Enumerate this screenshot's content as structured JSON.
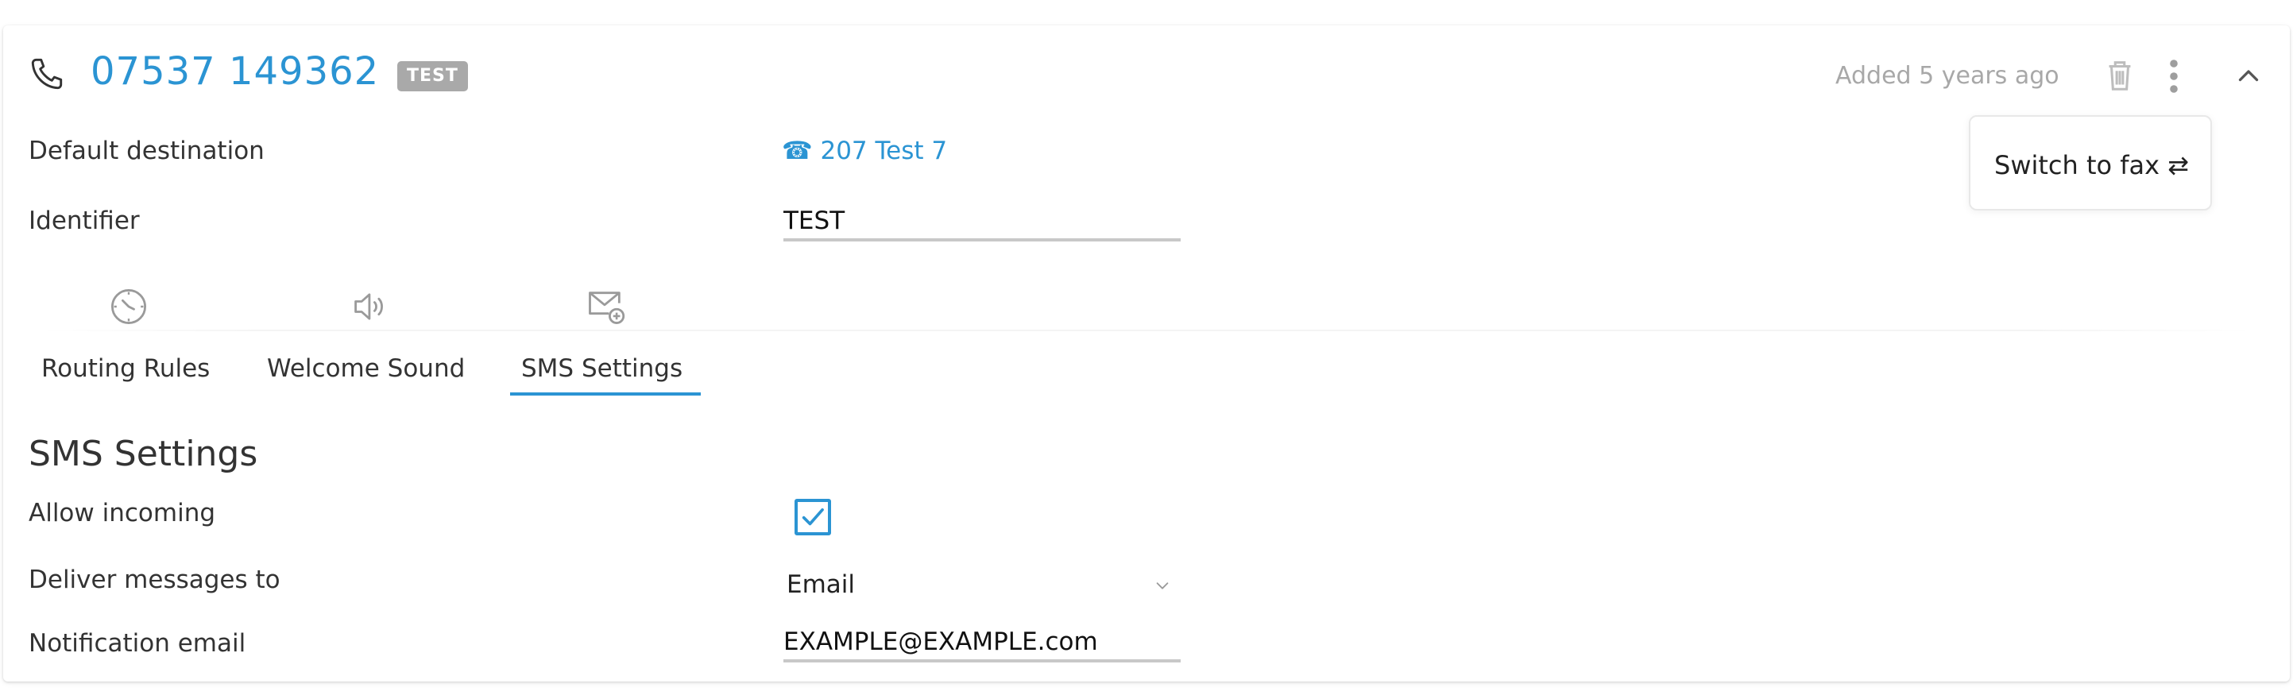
{
  "header": {
    "phone_number": "07537 149362",
    "badge": "TEST",
    "added_text": "Added 5 years ago"
  },
  "popover": {
    "switch_label": "Switch to fax ⇄"
  },
  "fields": {
    "default_destination_label": "Default destination",
    "default_destination_value": "☎ 207 Test 7",
    "identifier_label": "Identifier",
    "identifier_value": "TEST"
  },
  "tabs": [
    {
      "label": "Routing Rules",
      "icon": "clock-icon",
      "active": false
    },
    {
      "label": "Welcome Sound",
      "icon": "speaker-icon",
      "active": false
    },
    {
      "label": "SMS Settings",
      "icon": "envelope-plus-icon",
      "active": true
    }
  ],
  "sms": {
    "title": "SMS Settings",
    "allow_incoming_label": "Allow incoming",
    "allow_incoming_checked": true,
    "deliver_label": "Deliver messages to",
    "deliver_value": "Email",
    "notification_email_label": "Notification email",
    "notification_email_value": "EXAMPLE@EXAMPLE.com"
  },
  "colors": {
    "accent": "#2b94d3",
    "badge_bg": "#a9a9a9",
    "muted_text": "#a8a8a8"
  }
}
